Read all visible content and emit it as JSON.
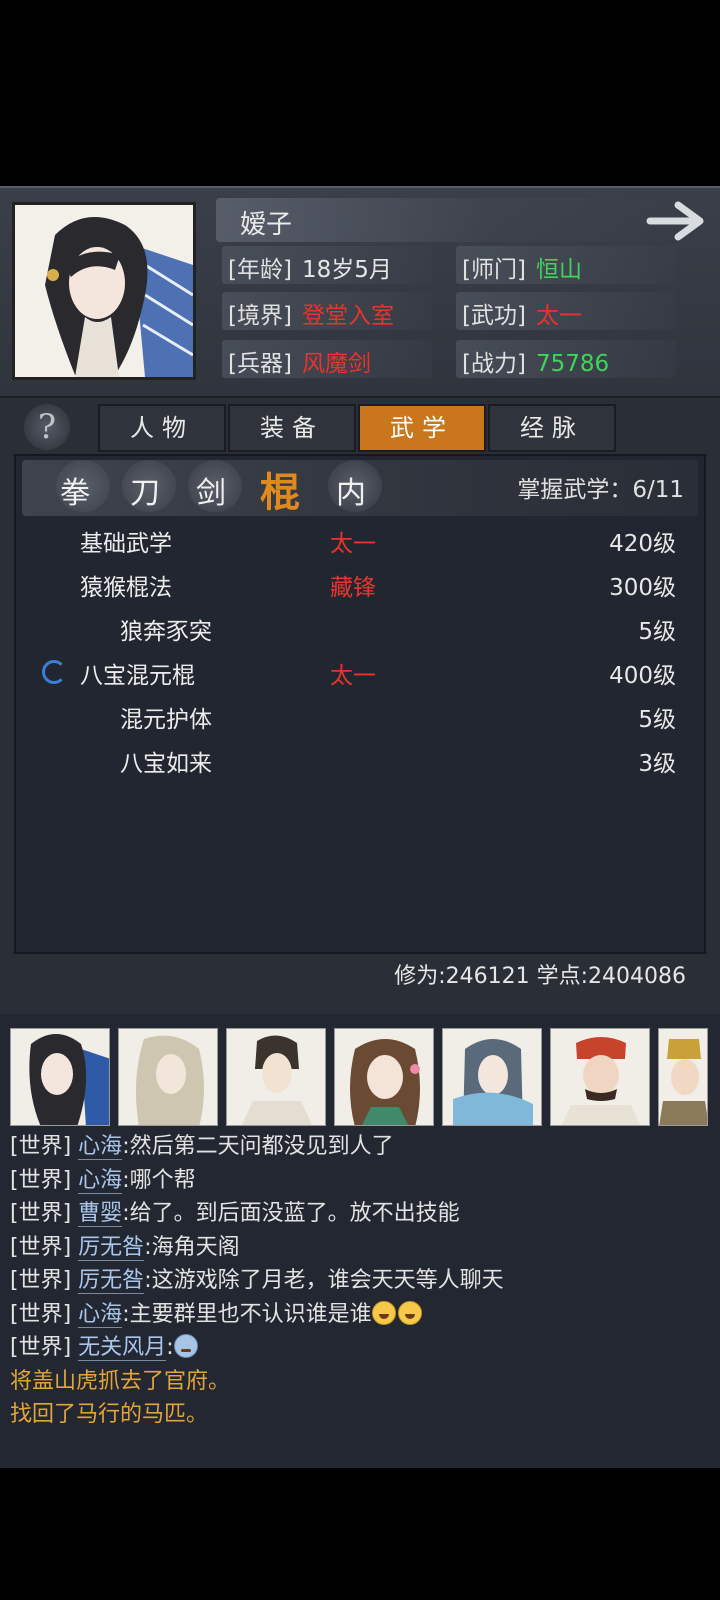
{
  "header": {
    "name": "嫒子",
    "age_label": "[年龄]",
    "age_value": "18岁5月",
    "sect_label": "[师门]",
    "sect_value": "恒山",
    "realm_label": "[境界]",
    "realm_value": "登堂入室",
    "martial_label": "[武功]",
    "martial_value": "太一",
    "weapon_label": "[兵器]",
    "weapon_value": "风魔剑",
    "power_label": "[战力]",
    "power_value": "75786"
  },
  "help_label": "?",
  "tabs": [
    {
      "label": "人物"
    },
    {
      "label": "装备"
    },
    {
      "label": "武学"
    },
    {
      "label": "经脉"
    }
  ],
  "categories": [
    {
      "label": "拳"
    },
    {
      "label": "刀"
    },
    {
      "label": "剑"
    },
    {
      "label": "棍"
    },
    {
      "label": "内"
    }
  ],
  "mastered": "掌握武学：6/11",
  "skills": [
    {
      "name": "基础武学",
      "style": "太一",
      "level": "420级"
    },
    {
      "name": "猿猴棍法",
      "style": "藏锋",
      "level": "300级"
    },
    {
      "name": "狼奔豕突",
      "style": "",
      "level": "5级"
    },
    {
      "name": "八宝混元棍",
      "style": "太一",
      "level": "400级"
    },
    {
      "name": "混元护体",
      "style": "",
      "level": "5级"
    },
    {
      "name": "八宝如来",
      "style": "",
      "level": "3级"
    }
  ],
  "stats": "修为:246121 学点:2404086",
  "chat": [
    {
      "channel": "[世界]",
      "who": "心海",
      "text": ":然后第二天问都没见到人了"
    },
    {
      "channel": "[世界]",
      "who": "心海",
      "text": ":哪个帮"
    },
    {
      "channel": "[世界]",
      "who": "曹婴",
      "text": ":给了。到后面没蓝了。放不出技能"
    },
    {
      "channel": "[世界]",
      "who": "厉无咎",
      "text": ":海角天阁"
    },
    {
      "channel": "[世界]",
      "who": "厉无咎",
      "text": ":这游戏除了月老，谁会天天等人聊天"
    },
    {
      "channel": "[世界]",
      "who": "心海",
      "text": ":主要群里也不认识谁是谁"
    },
    {
      "channel": "[世界]",
      "who": "无关风月",
      "text": ":"
    }
  ],
  "system_msgs": [
    "将盖山虎抓去了官府。",
    "找回了马行的马匹。"
  ],
  "colors": {
    "accent_tab": "#c9761c",
    "red_value": "#e8342c",
    "green_value": "#3fd45a",
    "system_text": "#e3a43a",
    "player_name": "#a9c6ea"
  }
}
